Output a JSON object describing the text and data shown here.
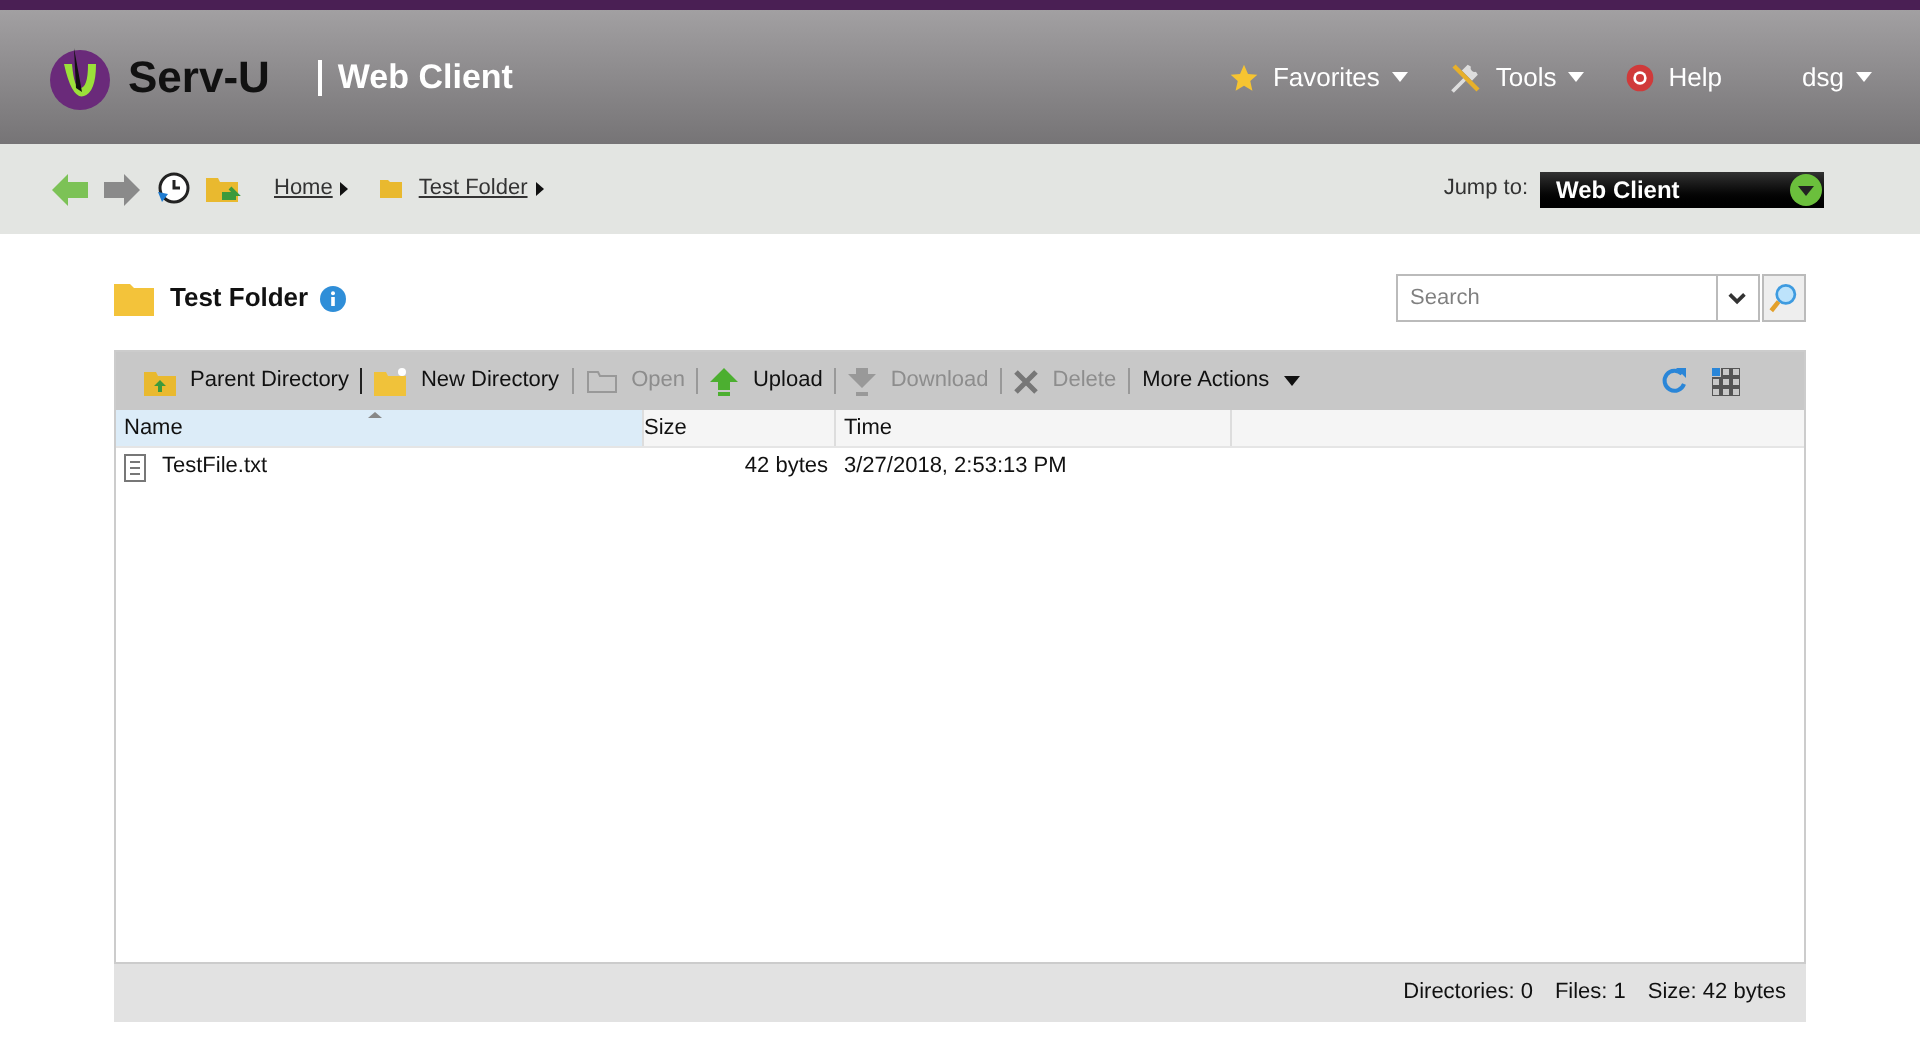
{
  "header": {
    "brand": "Serv-U",
    "product": "Web Client",
    "menu": [
      {
        "kind": "favorites",
        "label": "Favorites",
        "dropdown": true
      },
      {
        "kind": "tools",
        "label": "Tools",
        "dropdown": true
      },
      {
        "kind": "help",
        "label": "Help",
        "dropdown": false
      },
      {
        "kind": "user",
        "label": "dsg",
        "dropdown": true
      }
    ]
  },
  "breadcrumb": [
    {
      "label": "Home",
      "folder": false
    },
    {
      "label": "Test Folder",
      "folder": true
    }
  ],
  "jump_to": {
    "label": "Jump to:",
    "value": "Web Client"
  },
  "folder": {
    "title": "Test Folder"
  },
  "search": {
    "placeholder": "Search"
  },
  "toolbar": [
    {
      "kind": "parent",
      "label": "Parent Directory",
      "disabled": false
    },
    {
      "kind": "new",
      "label": "New Directory",
      "disabled": false
    },
    {
      "kind": "open",
      "label": "Open",
      "disabled": true
    },
    {
      "kind": "upload",
      "label": "Upload",
      "disabled": false
    },
    {
      "kind": "download",
      "label": "Download",
      "disabled": true
    },
    {
      "kind": "delete",
      "label": "Delete",
      "disabled": true
    },
    {
      "kind": "menu",
      "label": "More Actions",
      "disabled": false
    }
  ],
  "table": {
    "columns": [
      {
        "label": "Name",
        "selected": true
      },
      {
        "label": "Size",
        "selected": false
      },
      {
        "label": "Time",
        "selected": false
      }
    ],
    "rows": [
      {
        "name": "TestFile.txt",
        "size": "42 bytes",
        "time": "3/27/2018, 2:53:13 PM"
      }
    ]
  },
  "status_bar": [
    "Directories: 0",
    "Files: 1",
    "Size: 42 bytes"
  ]
}
